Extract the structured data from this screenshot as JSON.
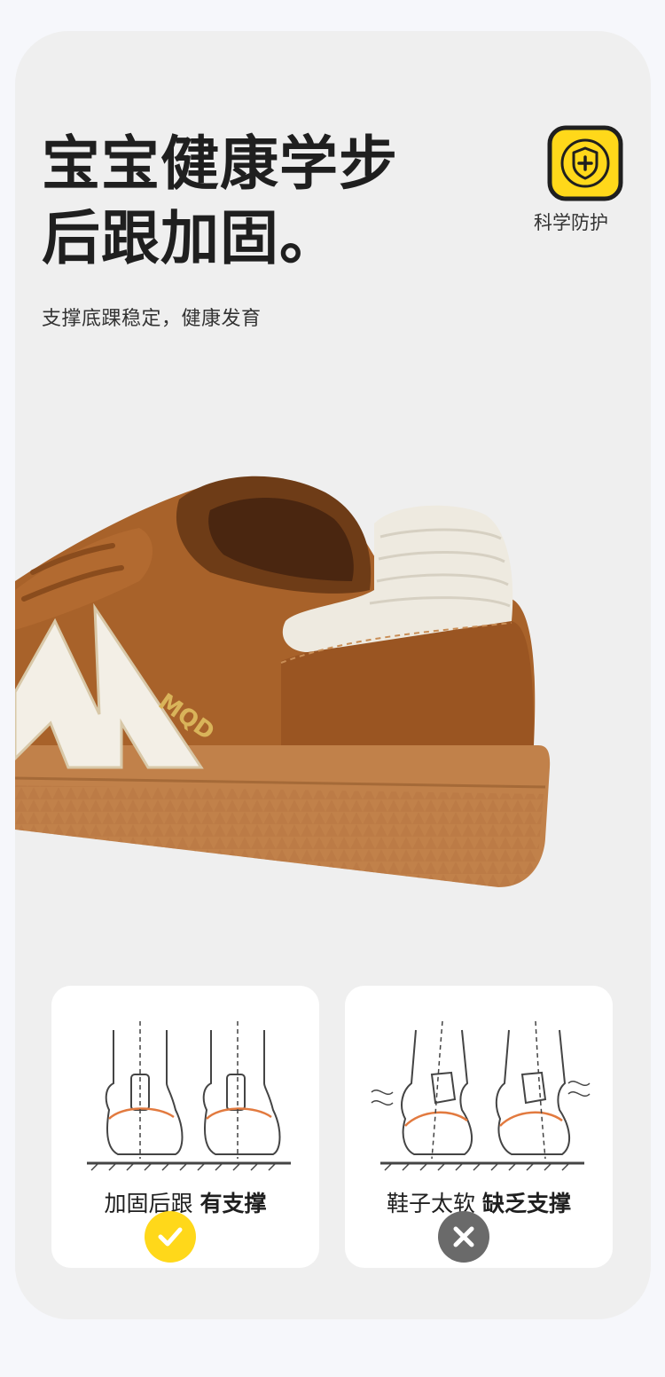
{
  "headline": {
    "line1": "宝宝健康学步",
    "line2": "后跟加固。"
  },
  "subtitle": "支撑底踝稳定，健康发育",
  "badge": {
    "icon": "shield-plus-icon",
    "label": "科学防护",
    "color": "#ffd81a"
  },
  "product": {
    "logo_text": "MQD"
  },
  "comparison": [
    {
      "caption_normal": "加固后跟",
      "caption_bold": "有支撑",
      "status": "check-icon",
      "status_color": "#ffd81a"
    },
    {
      "caption_normal": "鞋子太软",
      "caption_bold": "缺乏支撑",
      "status": "cross-icon",
      "status_color": "#6a6a6a"
    }
  ],
  "colors": {
    "background": "#f6f7fb",
    "card": "#efefef",
    "accent_yellow": "#ffd81a",
    "shoe_brown": "#a8622a",
    "sole_gum": "#c1814a"
  }
}
